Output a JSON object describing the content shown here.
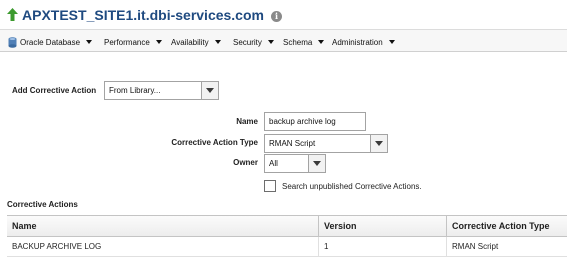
{
  "header": {
    "title": "APXTEST_SITE1.it.dbi-services.com",
    "info_glyph": "i",
    "status_icon": "up-arrow-icon",
    "status_color": "#3c9a2e"
  },
  "menubar": {
    "items": [
      {
        "label": "Oracle Database",
        "icon": "database-icon"
      },
      {
        "label": "Performance"
      },
      {
        "label": "Availability"
      },
      {
        "label": "Security"
      },
      {
        "label": "Schema"
      },
      {
        "label": "Administration"
      }
    ]
  },
  "form": {
    "add_corrective_action": {
      "label": "Add Corrective Action",
      "value": "From Library..."
    },
    "name": {
      "label": "Name",
      "value": "backup archive log"
    },
    "type": {
      "label": "Corrective Action Type",
      "value": "RMAN Script"
    },
    "owner": {
      "label": "Owner",
      "value": "All"
    },
    "search_unpublished": {
      "label": "Search unpublished Corrective Actions.",
      "checked": false
    }
  },
  "corrective_actions": {
    "title": "Corrective Actions",
    "columns": [
      "Name",
      "Version",
      "Corrective Action Type"
    ],
    "rows": [
      [
        "BACKUP ARCHIVE LOG",
        "1",
        "RMAN Script"
      ]
    ]
  },
  "colors": {
    "title": "#1f4a80",
    "menubar_bg": "#f7f7f7"
  }
}
